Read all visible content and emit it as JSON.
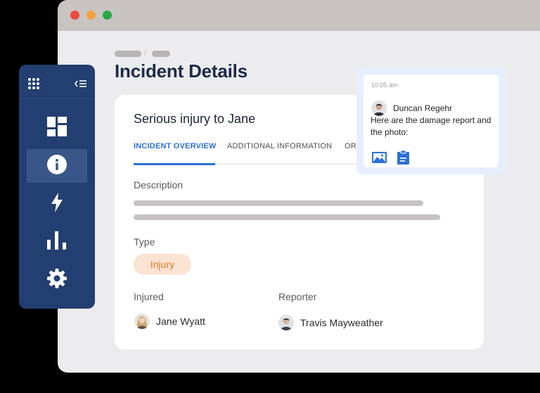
{
  "window": {
    "title": "",
    "controls": [
      "close",
      "minimize",
      "zoom"
    ]
  },
  "page": {
    "title": "Incident Details"
  },
  "sidebar": {
    "items": [
      {
        "icon": "dashboard-icon",
        "active": false
      },
      {
        "icon": "info-icon",
        "active": true
      },
      {
        "icon": "lightning-icon",
        "active": false
      },
      {
        "icon": "bar-chart-icon",
        "active": false
      },
      {
        "icon": "gear-icon",
        "active": false
      }
    ]
  },
  "incident": {
    "title": "Serious injury to Jane",
    "tabs": [
      {
        "label": "INCIDENT OVERVIEW",
        "active": true
      },
      {
        "label": "ADDITIONAL INFORMATION",
        "active": false
      },
      {
        "label": "ORI",
        "active": false
      }
    ],
    "description_label": "Description",
    "type_label": "Type",
    "type_value": "Injury",
    "injured_label": "Injured",
    "injured_name": "Jane Wyatt",
    "reporter_label": "Reporter",
    "reporter_name": "Travis Mayweather"
  },
  "chat": {
    "time": "10:05 am",
    "sender": "Duncan Regehr",
    "message": "Here are the damage report and the photo:",
    "attachments": [
      "image-attachment-icon",
      "clipboard-attachment-icon"
    ]
  },
  "colors": {
    "sidebar": "#233e70",
    "accent": "#2b6fdc",
    "badge_bg": "#fbe3d2",
    "badge_text": "#e0781e",
    "title": "#1c2a4a"
  }
}
